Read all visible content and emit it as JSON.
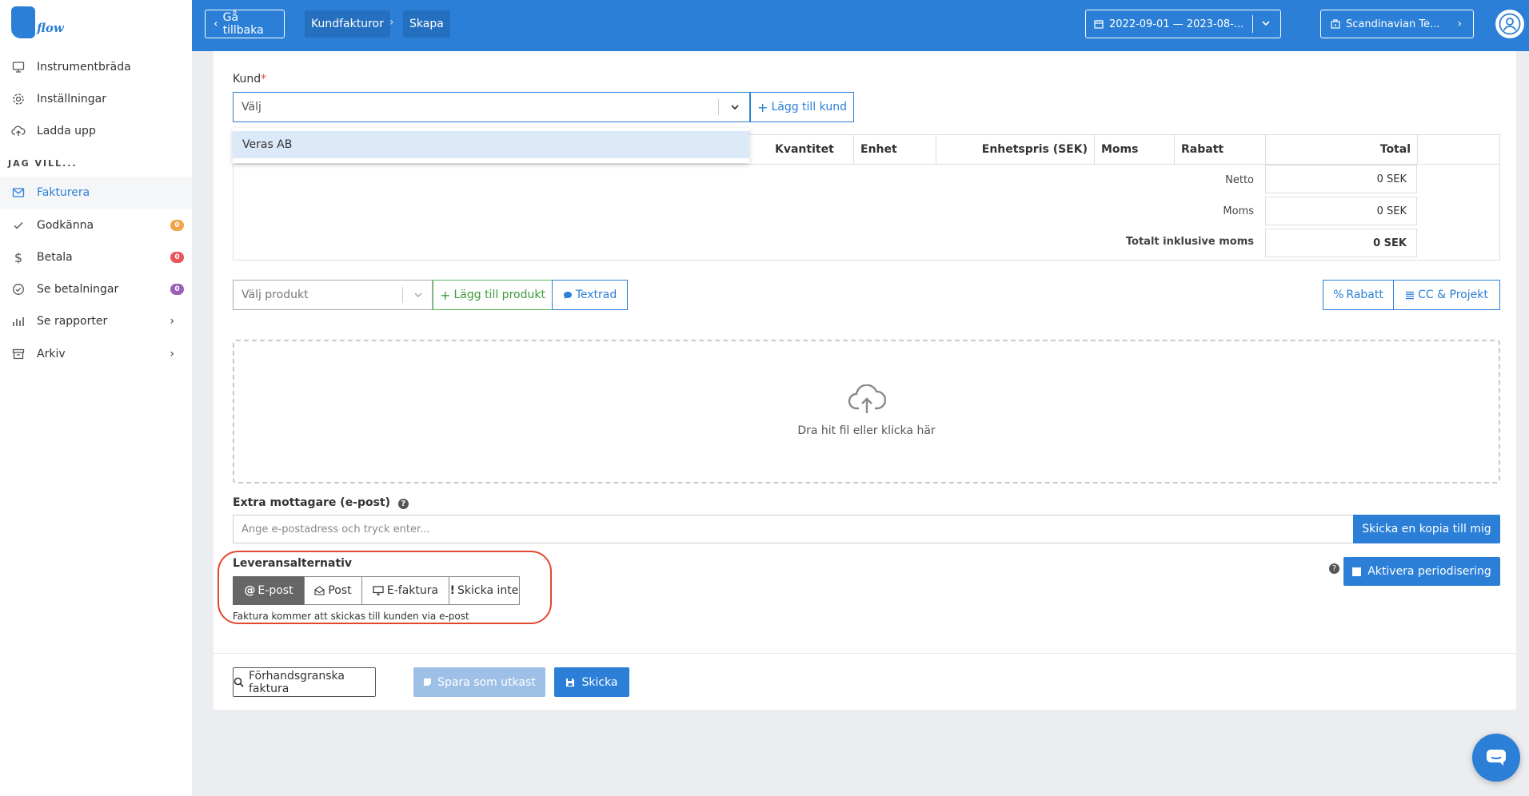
{
  "brand": {
    "logo_text": "flow",
    "accent": "#2b7fd6"
  },
  "sidebar": {
    "items": [
      {
        "label": "Instrumentbräda",
        "icon": "monitor-icon"
      },
      {
        "label": "Inställningar",
        "icon": "gear-icon"
      },
      {
        "label": "Ladda upp",
        "icon": "cloud-upload-icon"
      }
    ],
    "section_title": "JAG VILL...",
    "actions": [
      {
        "label": "Fakturera",
        "icon": "envelope-icon",
        "active": true
      },
      {
        "label": "Godkänna",
        "icon": "check-icon",
        "badge": "0",
        "badge_color": "#f0a54a"
      },
      {
        "label": "Betala",
        "icon": "dollar-icon",
        "badge": "0",
        "badge_color": "#e9545d"
      },
      {
        "label": "Se betalningar",
        "icon": "check-circle-icon",
        "badge": "0",
        "badge_color": "#9a5fb7"
      },
      {
        "label": "Se rapporter",
        "icon": "bar-chart-icon",
        "chevron": true
      },
      {
        "label": "Arkiv",
        "icon": "archive-icon",
        "chevron": true
      }
    ]
  },
  "header": {
    "back_label": "Gå tillbaka",
    "breadcrumbs": [
      "Kundfakturor",
      "Skapa"
    ],
    "date_range": "2022-09-01 — 2023-08-...",
    "company": "Scandinavian Te..."
  },
  "form": {
    "customer_label": "Kund",
    "customer_required": "*",
    "customer_select_value": "Välj",
    "add_customer_label": "Lägg till kund",
    "dropdown_options": [
      "Veras AB"
    ],
    "table_headers": [
      "Kvantitet",
      "Enhet",
      "Enhetspris (SEK)",
      "Moms",
      "Rabatt",
      "Total"
    ],
    "totals": [
      {
        "label": "Netto",
        "value": "0 SEK"
      },
      {
        "label": "Moms",
        "value": "0 SEK"
      },
      {
        "label": "Totalt inklusive moms",
        "value": "0 SEK"
      }
    ],
    "product_placeholder": "Välj produkt",
    "add_product_label": "Lägg till produkt",
    "textrad_label": "Textrad",
    "rabatt_label": "Rabatt",
    "cc_projekt_label": "CC & Projekt",
    "dropzone_text": "Dra hit fil eller klicka här",
    "extra_recipients_label": "Extra mottagare (e-post)",
    "email_placeholder": "Ange e-postadress och tryck enter...",
    "send_copy_label": "Skicka en kopia till mig",
    "delivery_label": "Leveransalternativ",
    "delivery_options": [
      "E-post",
      "Post",
      "E-faktura",
      "Skicka inte"
    ],
    "delivery_selected": "E-post",
    "delivery_hint": "Faktura kommer att skickas till kunden via e-post",
    "periodisering_label": "Aktivera periodisering"
  },
  "footer": {
    "preview_label": "Förhandsgranska faktura",
    "draft_label": "Spara som utkast",
    "send_label": "Skicka"
  },
  "colors": {
    "annotation_circle": "#e2472f",
    "selected_segment": "#666666"
  }
}
